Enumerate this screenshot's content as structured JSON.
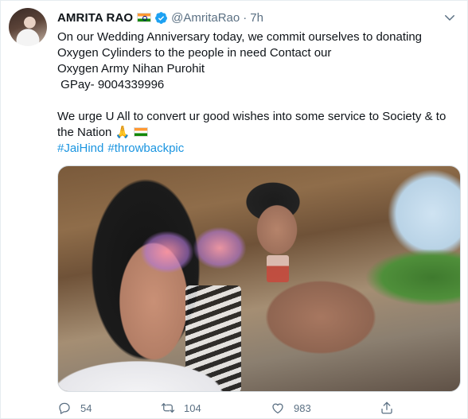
{
  "tweet": {
    "author": {
      "name": "AMRITA RAO",
      "handle": "@AmritaRao",
      "time": "7h"
    },
    "body_lines": [
      "On our Wedding Anniversary today, we commit ourselves to donating",
      "Oxygen Cylinders to the people in need Contact our",
      "Oxygen Army Nihan Purohit",
      " GPay- 9004339996",
      "",
      "We urge U All to convert ur good wishes into some service to Society & to",
      "the Nation 🙏"
    ],
    "hashtags": [
      "#JaiHind",
      "#throwbackpic"
    ],
    "stats": {
      "replies": "54",
      "retweets": "104",
      "likes": "983"
    }
  },
  "colors": {
    "link": "#1b95e0",
    "verified": "#1da1f2",
    "muted": "#5b7083"
  },
  "icons": [
    "india-flag-icon",
    "verified-badge-icon",
    "chevron-down-icon",
    "reply-icon",
    "retweet-icon",
    "heart-icon",
    "share-icon",
    "folded-hands-emoji"
  ]
}
